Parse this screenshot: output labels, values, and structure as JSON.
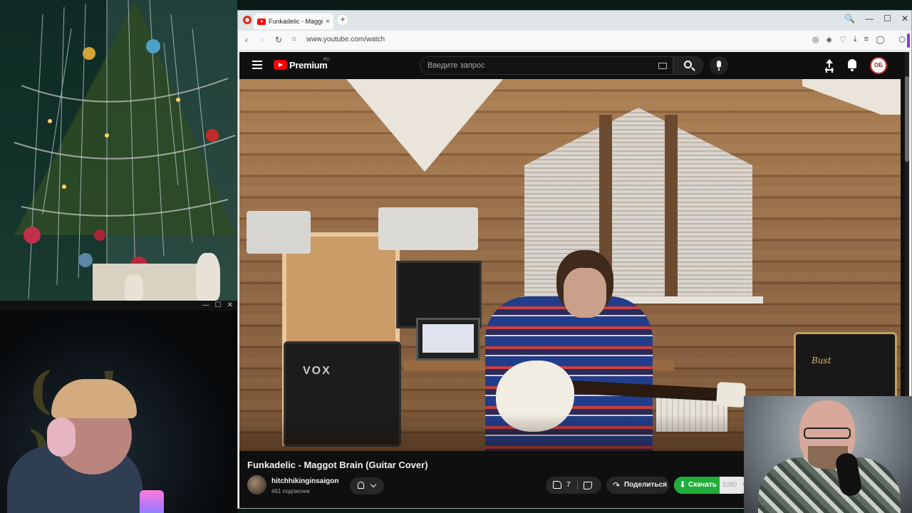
{
  "browser": {
    "tab_title": "Funkadelic - Maggot Brain",
    "tab_close": "×",
    "new_tab": "+",
    "url": "www.youtube.com/watch",
    "window_controls": [
      "🔍",
      "—",
      "☐",
      "✕"
    ]
  },
  "youtube": {
    "brand": "Premium",
    "region": "RU",
    "search_placeholder": "Введите запрос",
    "avatar_initials": "ОБ"
  },
  "video": {
    "title": "Funkadelic - Maggot Brain (Guitar Cover)",
    "amp_left_brand": "VOX",
    "amp_right_brand": "Bust"
  },
  "channel": {
    "name": "hitchhikinginsaigon",
    "subscribers": "461 подписчик"
  },
  "actions": {
    "likes": "7",
    "share_label": "Поделиться",
    "download_label": "Скачать",
    "download_quality": "1080"
  },
  "webcam_window": {
    "controls": [
      "—",
      "☐",
      "✕"
    ]
  },
  "colors": {
    "youtube_red": "#ff0000",
    "download_green": "#1fae3a",
    "opera_red": "#ee2211"
  }
}
